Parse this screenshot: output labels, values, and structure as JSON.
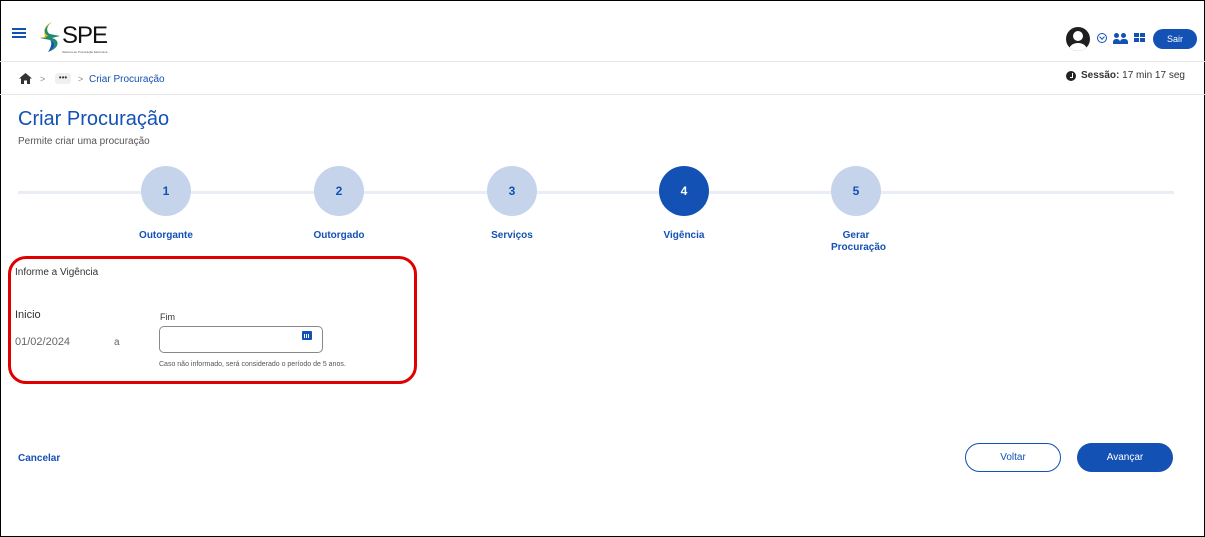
{
  "header": {
    "logo_text": "SPE",
    "logo_subtitle": "Sistema de Procuração Eletrônica",
    "sair_label": "Sair",
    "icons": [
      "menu-icon",
      "avatar-icon",
      "chevron-down-icon",
      "people-icon",
      "grid-icon"
    ]
  },
  "breadcrumb": {
    "dots": "•••",
    "current": "Criar Procuração",
    "separator": ">"
  },
  "session": {
    "label": "Sessão:",
    "value": " 17 min 17 seg"
  },
  "page": {
    "title": "Criar Procuração",
    "subtitle": "Permite criar uma procuração"
  },
  "stepper": {
    "active_step": 4,
    "steps": [
      {
        "number": "1",
        "label": "Outorgante"
      },
      {
        "number": "2",
        "label": "Outorgado"
      },
      {
        "number": "3",
        "label": "Serviços"
      },
      {
        "number": "4",
        "label": "Vigência"
      },
      {
        "number": "5",
        "label": "Gerar Procuração"
      }
    ]
  },
  "form": {
    "section_title": "Informe a Vigência",
    "inicio_label": "Inicio",
    "inicio_value": "01/02/2024",
    "separator_label": "a",
    "fim_label": "Fim",
    "fim_value": "",
    "hint": "Caso não informado, será considerado o período de 5 anos."
  },
  "actions": {
    "cancel": "Cancelar",
    "back": "Voltar",
    "next": "Avançar"
  },
  "colors": {
    "primary": "#1351b4",
    "step_inactive": "#c5d4eb",
    "highlight": "#e00000"
  }
}
